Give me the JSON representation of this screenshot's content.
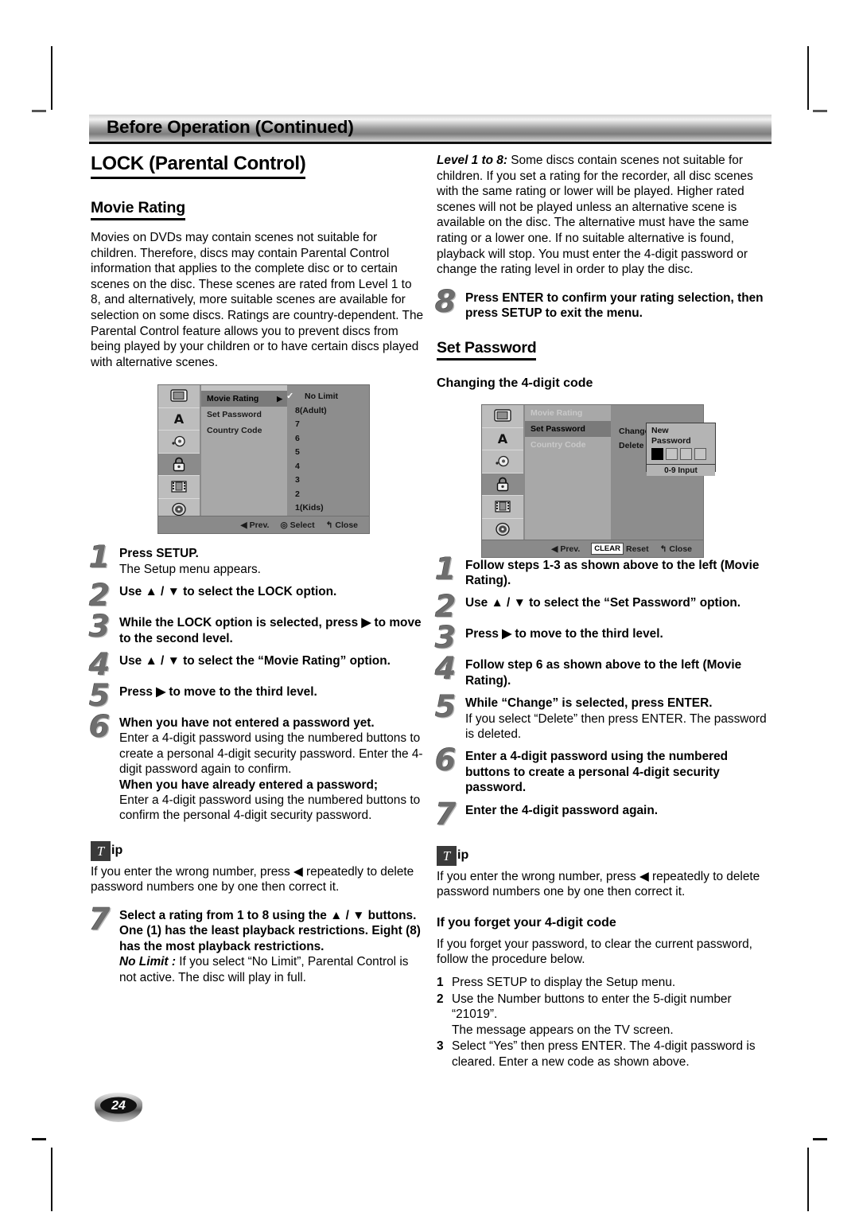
{
  "header": {
    "title": "Before Operation (Continued)"
  },
  "left": {
    "h1": "LOCK (Parental Control)",
    "h2": "Movie Rating",
    "intro": "Movies on DVDs may contain scenes not suitable for children. Therefore, discs may contain Parental Control information that applies to the complete disc or to certain scenes on the disc. These scenes are rated from Level 1 to 8, and alternatively, more suitable scenes are available for selection on some discs. Ratings are country-dependent. The Parental Control feature allows you to prevent discs from being played by your children or to have certain discs played with alternative scenes.",
    "steps": [
      {
        "num": "1",
        "bold": "Press SETUP.",
        "plain": "The Setup menu appears."
      },
      {
        "num": "2",
        "bold": "Use ▲ / ▼ to select the LOCK option.",
        "plain": ""
      },
      {
        "num": "3",
        "bold": "While the LOCK option is selected, press ▶ to move to the second level.",
        "plain": ""
      },
      {
        "num": "4",
        "bold": "Use ▲ / ▼ to select the “Movie Rating” option.",
        "plain": ""
      },
      {
        "num": "5",
        "bold": "Press ▶ to move to the third level.",
        "plain": ""
      }
    ],
    "step6": {
      "num": "6",
      "bold1": "When you have not entered a password yet.",
      "plain1": "Enter a 4-digit password using the numbered buttons to create a personal 4-digit security password. Enter the 4-digit password again to confirm.",
      "bold2": "When you have already entered a password;",
      "plain2": "Enter a 4-digit password using the numbered buttons to confirm the personal 4-digit security password."
    },
    "tip": {
      "t": "T",
      "ip": "ip",
      "text": "If you enter the wrong number, press ◀ repeatedly to delete password numbers one by one then correct it."
    },
    "step7": {
      "num": "7",
      "bold": "Select a rating from 1 to 8 using the ▲ / ▼ buttons. One (1) has the least playback restrictions. Eight (8) has the most playback restrictions.",
      "italic": "No Limit :",
      "plain": " If you select “No Limit”, Parental Control is not active. The disc will play in full."
    }
  },
  "right": {
    "level_label": "Level 1 to 8:",
    "level_text": " Some discs contain scenes not suitable for children. If you set a rating for the recorder, all disc scenes with the same rating or lower will be played. Higher rated scenes will not be played unless an alternative scene is available on the disc. The alternative must have the same rating or a lower one. If no suitable alternative is found, playback will stop. You must enter the 4-digit password or change the rating level in order to play the disc.",
    "step8": {
      "num": "8",
      "bold": "Press ENTER to confirm your rating selection, then press SETUP to exit the menu."
    },
    "h2": "Set Password",
    "h3": "Changing the 4-digit code",
    "steps": [
      {
        "num": "1",
        "bold": "Follow steps 1-3 as shown above to the left (Movie Rating).",
        "plain": ""
      },
      {
        "num": "2",
        "bold": "Use ▲ / ▼ to select the “Set Password” option.",
        "plain": ""
      },
      {
        "num": "3",
        "bold": "Press ▶ to move to the third level.",
        "plain": ""
      },
      {
        "num": "4",
        "bold": "Follow step 6 as shown above to the left (Movie Rating).",
        "plain": ""
      },
      {
        "num": "5",
        "bold": "While “Change” is selected, press ENTER.",
        "plain": "If you select “Delete” then press ENTER. The password is deleted."
      },
      {
        "num": "6",
        "bold": "Enter a 4-digit password using the numbered buttons to create a personal 4-digit security password.",
        "plain": ""
      },
      {
        "num": "7",
        "bold": "Enter the 4-digit password again.",
        "plain": ""
      }
    ],
    "tip": {
      "t": "T",
      "ip": "ip",
      "text": "If you enter the wrong number, press ◀ repeatedly to delete password numbers one by one then correct it."
    },
    "forgot": {
      "heading": "If you forget your 4-digit code",
      "intro": "If you forget your password, to clear the current password, follow the procedure below.",
      "items": [
        {
          "n": "1",
          "t": "Press SETUP to display the Setup menu."
        },
        {
          "n": "2",
          "t": "Use the Number buttons to enter the 5-digit number “21019”.\nThe message appears on the TV screen."
        },
        {
          "n": "3",
          "t": "Select “Yes” then press ENTER. The 4-digit password is cleared. Enter a new code as shown above."
        }
      ]
    }
  },
  "osd_movie_rating": {
    "sidebar_icons": [
      "tv-display-icon",
      "language-a-icon",
      "audio-icon",
      "lock-icon",
      "film-strip-icon",
      "disc-icon"
    ],
    "selected_icon_index": 3,
    "menu": [
      {
        "label": "Movie Rating",
        "state": "highlighted",
        "arrow": "▶"
      },
      {
        "label": "Set Password",
        "state": "normal",
        "arrow": ""
      },
      {
        "label": "Country Code",
        "state": "normal",
        "arrow": ""
      }
    ],
    "options": [
      "No Limit",
      "8(Adult)",
      "7",
      "6",
      "5",
      "4",
      "3",
      "2",
      "1(Kids)"
    ],
    "checked_option": "No Limit",
    "footer": {
      "prev": "Prev.",
      "select": "Select",
      "close": "Close"
    }
  },
  "osd_set_password": {
    "sidebar_icons": [
      "tv-display-icon",
      "language-a-icon",
      "audio-icon",
      "lock-icon",
      "film-strip-icon",
      "disc-icon"
    ],
    "selected_icon_index": 3,
    "menu": [
      {
        "label": "Movie Rating",
        "state": "dim",
        "arrow": ""
      },
      {
        "label": "Set Password",
        "state": "highlighted",
        "arrow": ""
      },
      {
        "label": "Country Code",
        "state": "dim",
        "arrow": ""
      }
    ],
    "options": [
      "Change",
      "Delete"
    ],
    "popup": {
      "line1": "New",
      "line2": "Password",
      "boxes": [
        true,
        false,
        false,
        false
      ],
      "input_hint": "0-9 Input"
    },
    "footer": {
      "prev": "Prev.",
      "clear": "CLEAR",
      "reset": "Reset",
      "close": "Close"
    }
  },
  "page_number": "24"
}
